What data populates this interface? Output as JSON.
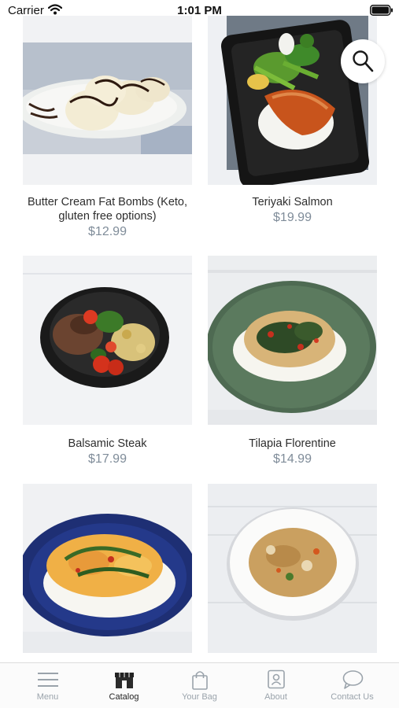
{
  "status_bar": {
    "carrier": "Carrier",
    "time": "1:01 PM"
  },
  "products": [
    {
      "name": "Butter Cream Fat Bombs (Keto, gluten free options)",
      "price": "$12.99",
      "image": "fat-bombs-photo"
    },
    {
      "name": "Teriyaki Salmon",
      "price": "$19.99",
      "image": "teriyaki-salmon-photo"
    },
    {
      "name": "Balsamic Steak",
      "price": "$17.99",
      "image": "balsamic-steak-photo"
    },
    {
      "name": "Tilapia Florentine",
      "price": "$14.99",
      "image": "tilapia-florentine-photo"
    },
    {
      "name": "",
      "price": "",
      "image": "shrimp-rice-blue-plate-photo"
    },
    {
      "name": "",
      "price": "",
      "image": "fried-rice-white-bowl-photo"
    }
  ],
  "search_button": {
    "icon": "search-icon"
  },
  "tab_bar": {
    "active": "Catalog",
    "tabs": [
      {
        "label": "Menu",
        "icon": "hamburger-menu-icon"
      },
      {
        "label": "Catalog",
        "icon": "storefront-icon"
      },
      {
        "label": "Your Bag",
        "icon": "shopping-bag-icon"
      },
      {
        "label": "About",
        "icon": "contact-card-icon"
      },
      {
        "label": "Contact Us",
        "icon": "speech-bubble-icon"
      }
    ]
  },
  "colors": {
    "price": "#7f8c99",
    "tab_inactive": "#9aa3ab",
    "tab_active": "#222222",
    "card_background": "#f1f2f4"
  }
}
